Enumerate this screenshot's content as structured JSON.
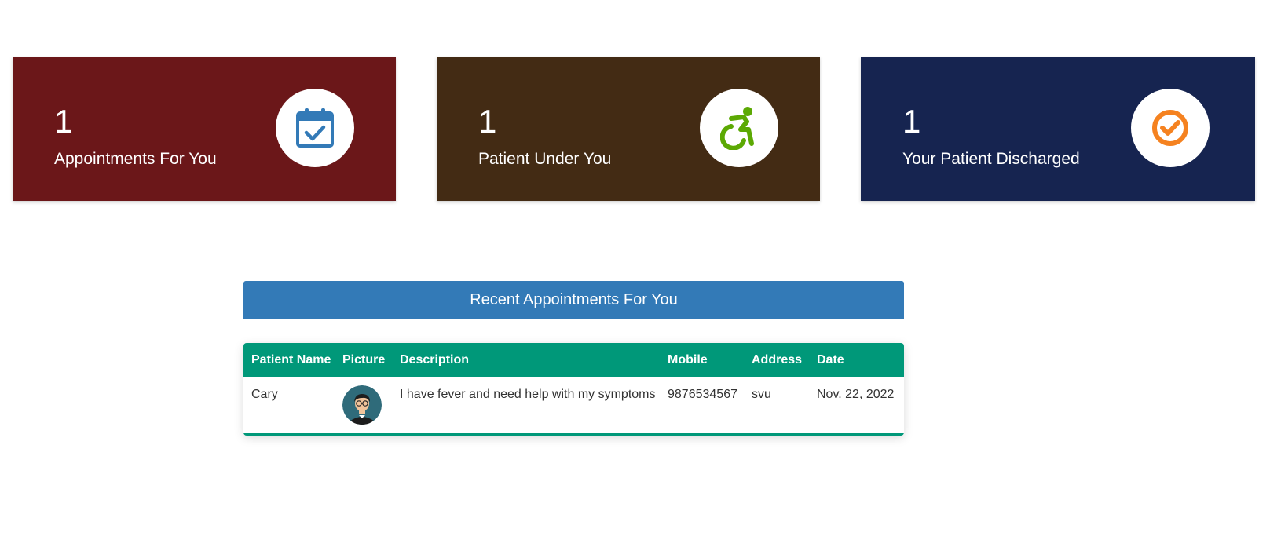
{
  "cards": [
    {
      "count": "1",
      "label": "Appointments For You",
      "icon": "calendar-check-icon",
      "bg_color": "#6b1719",
      "icon_color": "#337ab7"
    },
    {
      "count": "1",
      "label": "Patient Under You",
      "icon": "wheelchair-icon",
      "bg_color": "#432b14",
      "icon_color": "#5ca904"
    },
    {
      "count": "1",
      "label": "Your Patient Discharged",
      "icon": "check-circle-icon",
      "bg_color": "#162450",
      "icon_color": "#f58220"
    }
  ],
  "recent": {
    "title": "Recent Appointments For You",
    "header_color": "#337ab7"
  },
  "table": {
    "header_color": "#009879",
    "columns": [
      "Patient Name",
      "Picture",
      "Description",
      "Mobile",
      "Address",
      "Date"
    ],
    "rows": [
      {
        "patient_name": "Cary",
        "picture": "patient-avatar",
        "description": "I have fever and need help with my symptoms",
        "mobile": "9876534567",
        "address": "svu",
        "date": "Nov. 22, 2022"
      }
    ]
  }
}
